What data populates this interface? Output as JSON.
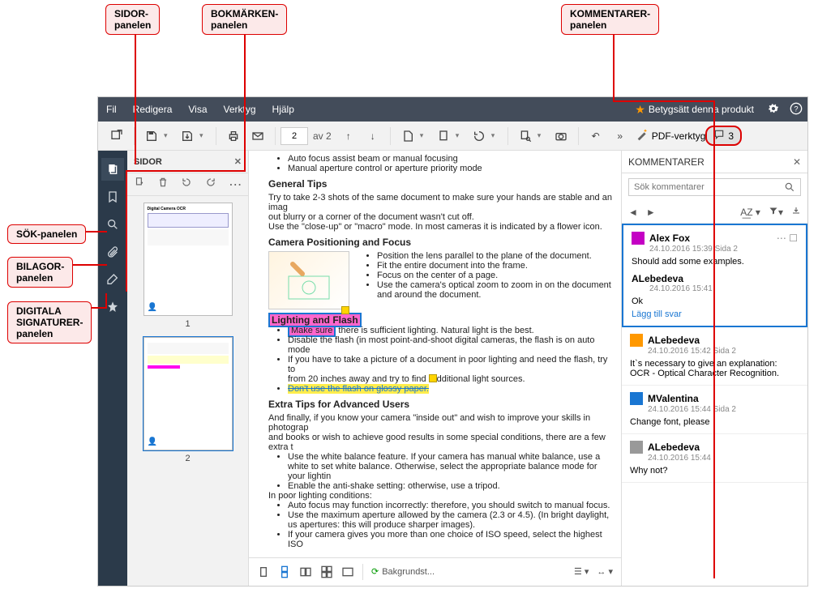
{
  "callouts": {
    "sidor": "SIDOR-\npanelen",
    "bokmarken": "BOKMÄRKEN-\npanelen",
    "kommentarer": "KOMMENTARER-\npanelen",
    "sok": "SÖK-panelen",
    "bilagor": "BILAGOR-\npanelen",
    "signaturer": "DIGITALA\nSIGNATURER-\npanelen"
  },
  "menu": {
    "file": "Fil",
    "edit": "Redigera",
    "view": "Visa",
    "tools": "Verktyg",
    "help": "Hjälp",
    "rate": "Betygsätt denna produkt"
  },
  "toolbar": {
    "page_current": "2",
    "page_of": "av 2",
    "pdf_tools": "PDF-verktyg",
    "comment_count": "3"
  },
  "pages_panel": {
    "title": "SIDOR",
    "thumbs": [
      "1",
      "2"
    ]
  },
  "doc": {
    "b1": "Auto focus assist beam or manual focusing",
    "b2": "Manual aperture control or aperture priority mode",
    "h1": "General Tips",
    "p1a": "Try to take 2-3 shots of the same document to make sure your hands are stable and an imag",
    "p1b": "out blurry or a corner of the document wasn't cut off.",
    "p1c": "Use the \"close-up\" or \"macro\" mode. In most cameras it is indicated by a flower icon.",
    "h2": "Camera Positioning and Focus",
    "c1": "Position the lens parallel to the plane of the document.",
    "c2": "Fit the entire document into the frame.",
    "c3": "Focus on the center of a page.",
    "c4": "Use the camera's optical zoom to zoom in on the document and around the document.",
    "h3a": "Lighting and Flash",
    "h3b": "Make sure",
    "l1": " there is sufficient lighting. Natural light is the best.",
    "l2": "Disable the flash (in most point-and-shoot digital cameras, the flash is on auto mode",
    "l3a": "If you have to take a picture of a document in poor lighting and need the flash, try to",
    "l3b": "from 20 inches away and try to find ",
    "l3c": "dditional light sources.",
    "l4": "Don't use the flash on glossy paper.",
    "h4": "Extra Tips for Advanced Users",
    "p4a": "And finally, if you know your camera \"inside out\" and wish to improve your skills in photograp",
    "p4b": "and books or wish to achieve good results in some special conditions, there are a few extra t",
    "e1": "Use the white balance feature. If your camera has manual white balance, use a white to set white balance. Otherwise, select the appropriate balance mode for your lightin",
    "e2": "Enable the anti-shake setting: otherwise, use a tripod.",
    "p5": "In poor lighting conditions:",
    "f1": "Auto focus may function incorrectly: therefore, you should switch to manual focus.",
    "f2": "Use the maximum aperture allowed by the camera (2.3 or 4.5). (In bright daylight, us apertures: this will produce sharper images).",
    "f3": "If your camera gives you more than one choice of ISO speed, select the highest ISO"
  },
  "status": {
    "bg": "Bakgrundst..."
  },
  "comments": {
    "title": "KOMMENTARER",
    "search_placeholder": "Sök kommentarer",
    "items": [
      {
        "author": "Alex Fox",
        "meta": "24.10.2016 15:39  Sida 2",
        "body": "Should add some examples.",
        "selected": true,
        "color": "avp",
        "reply": {
          "author": "ALebedeva",
          "meta": "24.10.2016 15:41",
          "body": "Ok"
        },
        "reply_link": "Lägg till svar"
      },
      {
        "author": "ALebedeva",
        "meta": "24.10.2016 15:42  Sida 2",
        "body": "It`s necessary to give an explanation: OCR - Optical Character Recognition.",
        "color": "avy"
      },
      {
        "author": "MValentina",
        "meta": "24.10.2016 15:44  Sida 2",
        "body": "Change font, please",
        "color": "avb"
      },
      {
        "author": "ALebedeva",
        "meta": "24.10.2016 15:44",
        "body": "Why not?",
        "color": "avg"
      }
    ]
  }
}
